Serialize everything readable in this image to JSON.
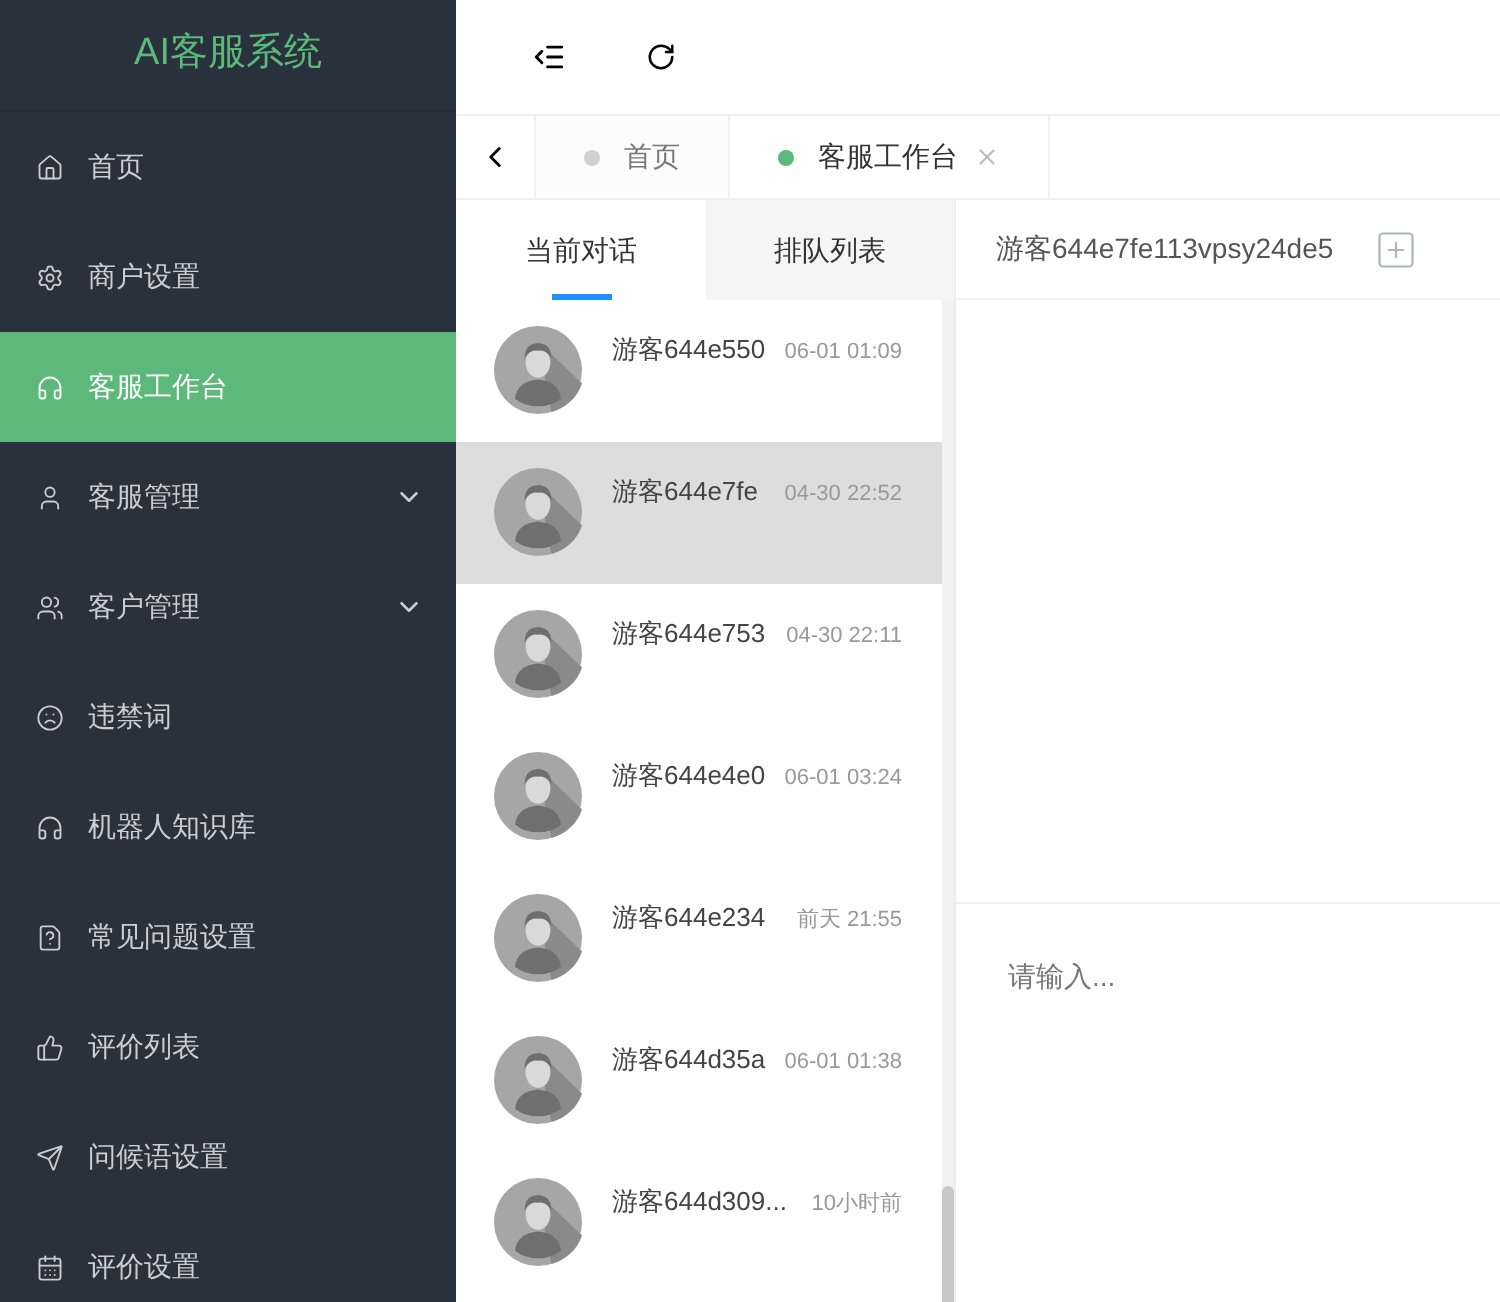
{
  "sidebar": {
    "logo": "AI客服系统",
    "items": [
      {
        "label": "首页",
        "selected": false
      },
      {
        "label": "商户设置",
        "selected": false
      },
      {
        "label": "客服工作台",
        "selected": true
      },
      {
        "label": "客服管理",
        "selected": false,
        "expanded": false
      },
      {
        "label": "客户管理",
        "selected": false,
        "expanded": false
      },
      {
        "label": "违禁词",
        "selected": false
      },
      {
        "label": "机器人知识库",
        "selected": false
      },
      {
        "label": "常见问题设置",
        "selected": false
      },
      {
        "label": "评价列表",
        "selected": false
      },
      {
        "label": "问候语设置",
        "selected": false
      },
      {
        "label": "评价设置",
        "selected": false
      }
    ]
  },
  "page_tabs": [
    {
      "label": "首页",
      "selected": false,
      "closable": false
    },
    {
      "label": "客服工作台",
      "selected": true,
      "closable": true
    }
  ],
  "conversation_tabs": [
    {
      "label": "当前对话",
      "selected": true
    },
    {
      "label": "排队列表",
      "selected": false
    }
  ],
  "conversations": [
    {
      "name": "游客644e550",
      "time": "06-01 01:09",
      "selected": false
    },
    {
      "name": "游客644e7fe",
      "time": "04-30 22:52",
      "selected": true
    },
    {
      "name": "游客644e753",
      "time": "04-30 22:11",
      "selected": false
    },
    {
      "name": "游客644e4e0",
      "time": "06-01 03:24",
      "selected": false
    },
    {
      "name": "游客644e234",
      "time": "前天 21:55",
      "selected": false
    },
    {
      "name": "游客644d35a",
      "time": "06-01 01:38",
      "selected": false
    },
    {
      "name": "游客644d309...",
      "time": "10小时前",
      "selected": false
    }
  ],
  "chat": {
    "title": "游客644e7fe113vpsy24de5",
    "input": {
      "placeholder": "请输入..."
    }
  }
}
